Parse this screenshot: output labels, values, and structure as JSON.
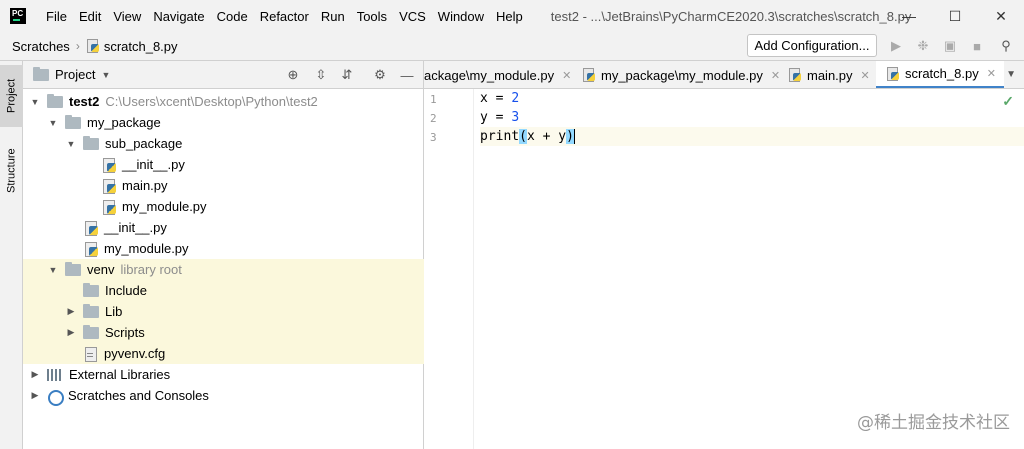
{
  "menubar": {
    "items": [
      "File",
      "Edit",
      "View",
      "Navigate",
      "Code",
      "Refactor",
      "Run",
      "Tools",
      "VCS",
      "Window",
      "Help"
    ],
    "window_title": "test2 - ...\\JetBrains\\PyCharmCE2020.3\\scratches\\scratch_8.py"
  },
  "navbar": {
    "crumb1": "Scratches",
    "crumb2": "scratch_8.py",
    "add_configuration": "Add Configuration..."
  },
  "sidebar": {
    "tab_project": "Project",
    "tab_structure": "Structure"
  },
  "project_panel": {
    "title": "Project",
    "tree": [
      {
        "label": "test2",
        "hint": "C:\\Users\\xcent\\Desktop\\Python\\test2"
      },
      {
        "label": "my_package"
      },
      {
        "label": "sub_package"
      },
      {
        "label": "__init__.py"
      },
      {
        "label": "main.py"
      },
      {
        "label": "my_module.py"
      },
      {
        "label": "__init__.py"
      },
      {
        "label": "my_module.py"
      },
      {
        "label": "venv",
        "hint": "library root"
      },
      {
        "label": "Include"
      },
      {
        "label": "Lib"
      },
      {
        "label": "Scripts"
      },
      {
        "label": "pyvenv.cfg"
      },
      {
        "label": "External Libraries"
      },
      {
        "label": "Scratches and Consoles"
      }
    ]
  },
  "editor": {
    "tabs": [
      {
        "label": "ackage\\my_module.py"
      },
      {
        "label": "my_package\\my_module.py"
      },
      {
        "label": "main.py"
      },
      {
        "label": "scratch_8.py"
      }
    ],
    "lines": [
      "1",
      "2",
      "3"
    ],
    "code": {
      "l1_var": "x",
      "l1_op": " = ",
      "l1_val": "2",
      "l2_var": "y",
      "l2_op": " = ",
      "l2_val": "3",
      "l3_fn": "print",
      "l3_open": "(",
      "l3_body": "x + y",
      "l3_close": ")"
    }
  },
  "watermark": "@稀土掘金技术社区"
}
